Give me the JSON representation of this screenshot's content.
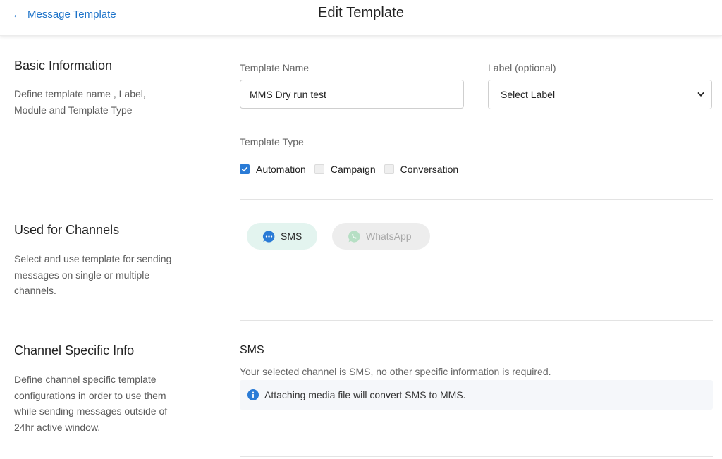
{
  "header": {
    "back_label": "Message Template",
    "title": "Edit Template"
  },
  "basic_info": {
    "title": "Basic Information",
    "description": "Define template name , Label, Module and Template Type",
    "name_label": "Template Name",
    "name_value": "MMS Dry run test",
    "label_label": "Label (optional)",
    "label_selected": "Select Label",
    "type_label": "Template Type",
    "types": [
      {
        "label": "Automation",
        "checked": true
      },
      {
        "label": "Campaign",
        "checked": false
      },
      {
        "label": "Conversation",
        "checked": false
      }
    ]
  },
  "channels": {
    "title": "Used for Channels",
    "description": "Select and use template for sending messages on single or multiple channels.",
    "items": [
      {
        "label": "SMS",
        "icon": "sms-chat-icon",
        "active": true,
        "color": "#2a7bd6"
      },
      {
        "label": "WhatsApp",
        "icon": "whatsapp-icon",
        "active": false,
        "color": "#b6dfc4"
      }
    ]
  },
  "channel_info": {
    "title": "Channel Specific Info",
    "description": "Define channel specific template configurations in order to use them while sending messages outside of 24hr active window.",
    "sms_heading": "SMS",
    "sms_note": "Your selected channel is SMS, no other specific information is required.",
    "info_text": "Attaching media file will convert SMS to MMS."
  },
  "colors": {
    "accent": "#2a7bd6",
    "link": "#1d73c9"
  }
}
